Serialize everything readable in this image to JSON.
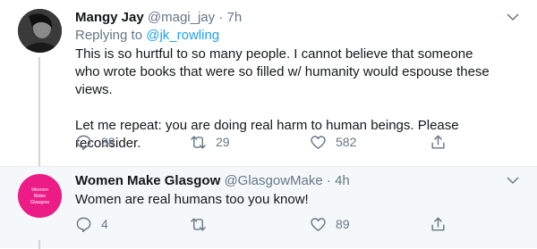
{
  "tweets": [
    {
      "name": "Mangy Jay",
      "handle": "@magi_jay",
      "dot": "·",
      "time": "7h",
      "reply_prefix": "Replying to ",
      "reply_to": "@jk_rowling",
      "text": "This is so hurtful to so many people. I cannot believe that someone who wrote books that were so filled w/ humanity would espouse these views.\n\nLet me repeat: you are doing real harm to human beings. Please reconsider.",
      "replies": "38",
      "retweets": "29",
      "likes": "582"
    },
    {
      "name": "Women Make Glasgow",
      "handle": "@GlasgowMake",
      "dot": "·",
      "time": "4h",
      "avatar_text": "Women Make Glasgow",
      "text": "Women are real humans too you know!",
      "replies": "4",
      "retweets": "",
      "likes": "89"
    }
  ],
  "colors": {
    "secondary_text": "#657786",
    "link": "#1da1f2",
    "avatar2": "#ec1b85"
  }
}
